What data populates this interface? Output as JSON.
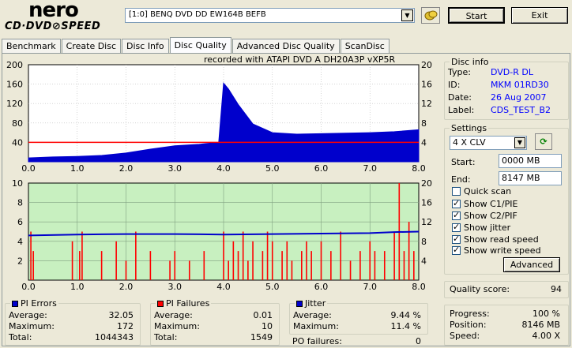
{
  "logo": {
    "brand": "nero",
    "product": "CD·DVD⊘SPEED"
  },
  "toolbar": {
    "drive_value": "[1:0]  BENQ DVD DD EW164B BEFB",
    "start_label": "Start",
    "exit_label": "Exit"
  },
  "tabs": [
    {
      "label": "Benchmark",
      "active": false
    },
    {
      "label": "Create Disc",
      "active": false
    },
    {
      "label": "Disc Info",
      "active": false
    },
    {
      "label": "Disc Quality",
      "active": true
    },
    {
      "label": "Advanced Disc Quality",
      "active": false
    },
    {
      "label": "ScanDisc",
      "active": false
    }
  ],
  "caption": "recorded with ATAPI   DVD  A   DH20A3P   vXP5R",
  "disc_info": {
    "title": "Disc info",
    "type_label": "Type:",
    "type_value": "DVD-R DL",
    "id_label": "ID:",
    "id_value": "MKM 01RD30",
    "date_label": "Date:",
    "date_value": "26 Aug 2007",
    "label_label": "Label:",
    "label_value": "CDS_TEST_B2"
  },
  "settings": {
    "title": "Settings",
    "speed_value": "4 X CLV",
    "start_label": "Start:",
    "start_value": "0000 MB",
    "end_label": "End:",
    "end_value": "8147 MB",
    "quick_scan": "Quick scan",
    "show_c1": "Show C1/PIE",
    "show_c2": "Show C2/PIF",
    "show_jitter": "Show jitter",
    "show_read": "Show read speed",
    "show_write": "Show write speed",
    "advanced_label": "Advanced",
    "checks": {
      "quick_scan": false,
      "c1": true,
      "c2": true,
      "jitter": true,
      "read": true,
      "write": true
    }
  },
  "quality": {
    "label": "Quality score:",
    "value": "94"
  },
  "progress": {
    "progress_label": "Progress:",
    "progress_value": "100 %",
    "position_label": "Position:",
    "position_value": "8146 MB",
    "speed_label": "Speed:",
    "speed_value": "4.00 X"
  },
  "pi_errors": {
    "title": "PI Errors",
    "color": "#0000cc",
    "avg_label": "Average:",
    "avg": "32.05",
    "max_label": "Maximum:",
    "max": "172",
    "total_label": "Total:",
    "total": "1044343"
  },
  "pi_failures": {
    "title": "PI Failures",
    "color": "#ff0000",
    "avg_label": "Average:",
    "avg": "0.01",
    "max_label": "Maximum:",
    "max": "10",
    "total_label": "Total:",
    "total": "1549"
  },
  "jitter": {
    "title": "Jitter",
    "color": "#0000cc",
    "avg_label": "Average:",
    "avg": "9.44 %",
    "max_label": "Maximum:",
    "max": "11.4 %",
    "po_label": "PO failures:",
    "po": "0"
  },
  "chart_data": [
    {
      "type": "area",
      "x_ticks": [
        "0.0",
        "1.0",
        "2.0",
        "3.0",
        "4.0",
        "5.0",
        "6.0",
        "7.0",
        "8.0"
      ],
      "xlim": [
        0,
        8
      ],
      "y_left_ticks": [
        "200",
        "160",
        "120",
        "80",
        "40"
      ],
      "ylim_left": [
        0,
        200
      ],
      "y_right_ticks": [
        "20",
        "16",
        "12",
        "8",
        "4"
      ],
      "ylim_right": [
        0,
        20
      ],
      "series": [
        {
          "color": "#0000cc",
          "x": [
            0,
            0.5,
            1.0,
            1.5,
            2.0,
            2.5,
            3.0,
            3.5,
            3.9,
            4.0,
            4.1,
            4.3,
            4.6,
            5.0,
            5.5,
            6.0,
            6.5,
            7.0,
            7.5,
            8.0
          ],
          "values": [
            8,
            10,
            11,
            13,
            18,
            26,
            33,
            36,
            40,
            162,
            150,
            118,
            78,
            60,
            57,
            58,
            59,
            60,
            62,
            66
          ]
        },
        {
          "color": "#ff0000",
          "x": [
            0,
            8
          ],
          "values": [
            4,
            4
          ]
        }
      ]
    },
    {
      "type": "bar",
      "x_ticks": [
        "0.0",
        "1.0",
        "2.0",
        "3.0",
        "4.0",
        "5.0",
        "6.0",
        "7.0",
        "8.0"
      ],
      "xlim": [
        0,
        8
      ],
      "y_left_ticks": [
        "10",
        "8",
        "6",
        "4",
        "2"
      ],
      "ylim_left": [
        0,
        10
      ],
      "y_right_ticks": [
        "20",
        "16",
        "12",
        "8",
        "4"
      ],
      "ylim_right": [
        0,
        20
      ],
      "series": [
        {
          "color": "#ff0000",
          "x": [
            0.05,
            0.1,
            0.9,
            1.05,
            1.1,
            1.5,
            1.8,
            2.0,
            2.2,
            2.5,
            2.9,
            3.0,
            3.3,
            3.6,
            4.0,
            4.1,
            4.2,
            4.3,
            4.4,
            4.5,
            4.6,
            4.8,
            4.9,
            5.0,
            5.2,
            5.3,
            5.4,
            5.6,
            5.7,
            5.8,
            6.0,
            6.2,
            6.4,
            6.6,
            6.8,
            7.0,
            7.1,
            7.3,
            7.5,
            7.6,
            7.7,
            7.8,
            7.9
          ],
          "values": [
            5,
            3,
            4,
            3,
            5,
            3,
            4,
            2,
            5,
            3,
            2,
            3,
            2,
            3,
            5,
            2,
            4,
            3,
            5,
            2,
            4,
            3,
            5,
            4,
            3,
            4,
            2,
            3,
            4,
            3,
            4,
            3,
            5,
            2,
            3,
            4,
            3,
            3,
            5,
            10,
            3,
            6,
            3
          ]
        },
        {
          "color": "#0000cc",
          "x": [
            0,
            1,
            2,
            3,
            4,
            5,
            6,
            7,
            7.5,
            8
          ],
          "values": [
            9.2,
            9.4,
            9.5,
            9.5,
            9.4,
            9.5,
            9.6,
            9.7,
            9.9,
            10.0
          ]
        }
      ]
    }
  ]
}
